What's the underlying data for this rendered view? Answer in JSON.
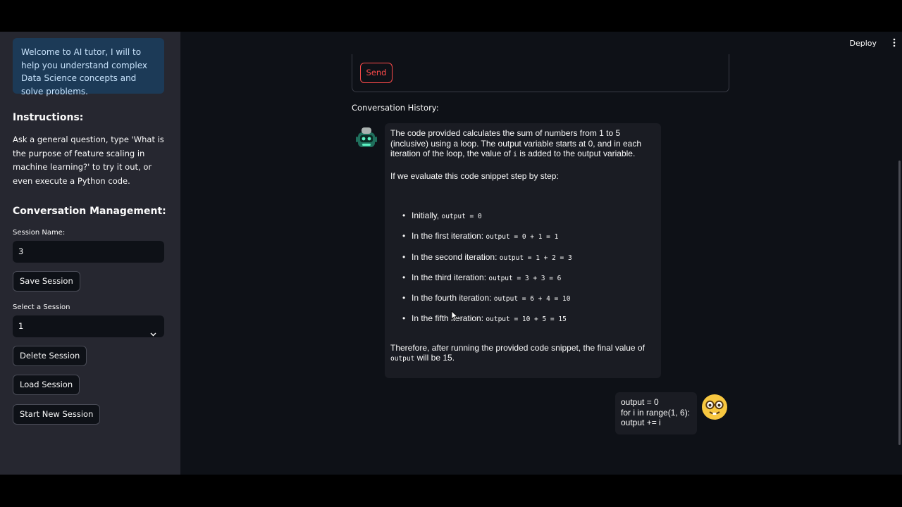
{
  "sidebar": {
    "info": "Welcome to AI tutor, I will to help you understand complex Data Science concepts and solve problems.",
    "instructions_heading": "Instructions:",
    "instructions_text": "Ask a general question, type 'What is the purpose of feature scaling in machine learning?' to try it out, or even execute a Python code.",
    "management_heading": "Conversation Management:",
    "session_name_label": "Session Name:",
    "session_name_value": "3",
    "save_label": "Save Session",
    "select_label": "Select a Session",
    "select_value": "1",
    "delete_label": "Delete Session",
    "load_label": "Load Session",
    "new_label": "Start New Session"
  },
  "header": {
    "deploy_label": "Deploy"
  },
  "main": {
    "send_label": "Send",
    "history_label": "Conversation History:",
    "assistant_message": {
      "intro_a": "The code provided calculates the sum of numbers from 1 to 5 (inclusive) using a loop. The output variable starts at 0, and in each iteration of the loop, the value of ",
      "intro_code": "i",
      "intro_b": " is added to the output variable.",
      "evaluate": "If we evaluate this code snippet step by step:",
      "steps": [
        {
          "text": "Initially, ",
          "code": "output = 0"
        },
        {
          "text": "In the first iteration: ",
          "code": "output = 0 + 1 = 1"
        },
        {
          "text": "In the second iteration: ",
          "code": "output = 1 + 2 = 3"
        },
        {
          "text": "In the third iteration: ",
          "code": "output = 3 + 3 = 6"
        },
        {
          "text": "In the fourth iteration: ",
          "code": "output = 6 + 4 = 10"
        },
        {
          "text": "In the fifth iteration: ",
          "code": "output = 10 + 5 = 15"
        }
      ],
      "conclusion_a": "Therefore, after running the provided code snippet, the final value of ",
      "conclusion_code": "output",
      "conclusion_b": " will be 15."
    },
    "user_message": {
      "line1": "output = 0",
      "line2": "for i in range(1, 6):",
      "line3": "output += i"
    }
  },
  "icons": {
    "assistant_avatar": "robot-icon",
    "user_avatar": "nerd-face-icon",
    "menu": "kebab-menu-icon",
    "select_caret": "chevron-down-icon"
  },
  "colors": {
    "background": "#0e1117",
    "sidebar": "#262730",
    "info_bg": "#1c3a57",
    "info_text": "#c7e2fb",
    "accent": "#ff4b4b",
    "bubble": "#1a1c23"
  }
}
